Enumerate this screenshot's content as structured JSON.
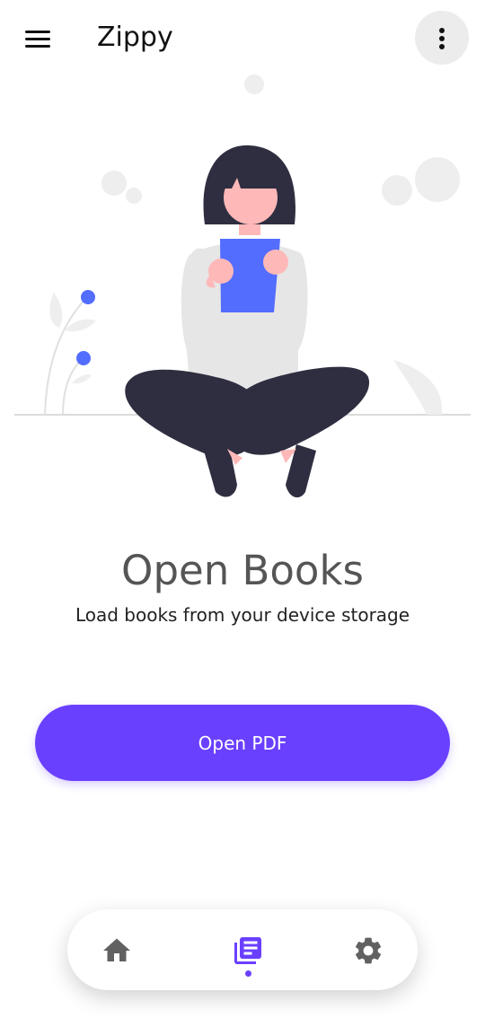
{
  "app": {
    "title": "Zippy"
  },
  "header": {
    "menu_icon": "hamburger-menu-icon",
    "more_icon": "more-vertical-icon"
  },
  "empty_state": {
    "title": "Open Books",
    "subtitle": "Load books from your device storage",
    "illustration": "person-reading-book-illustration"
  },
  "actions": {
    "open_pdf_label": "Open PDF"
  },
  "bottom_nav": {
    "items": [
      {
        "name": "home",
        "icon": "home-icon",
        "active": false
      },
      {
        "name": "library",
        "icon": "library-books-icon",
        "active": true
      },
      {
        "name": "settings",
        "icon": "gear-icon",
        "active": false
      }
    ]
  },
  "colors": {
    "accent": "#6a40ff",
    "book": "#536dfe",
    "hair_and_pants": "#2f2e41",
    "skin": "#ffb8b8",
    "shirt": "#e6e6e6",
    "nav_inactive": "#616161"
  }
}
